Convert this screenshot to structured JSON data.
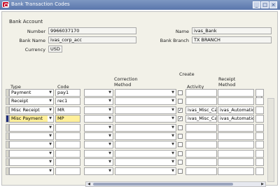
{
  "window": {
    "title": "Bank Transaction Codes",
    "buttons": [
      "_",
      "□",
      "×"
    ]
  },
  "bank_account": {
    "section_title": "Bank Account",
    "number_label": "Number",
    "number_value": "9966037170",
    "bank_name_label": "Bank Name",
    "bank_name_value": "ivas_corp_acc",
    "currency_label": "Currency",
    "currency_value": "USD",
    "name_label": "Name",
    "name_value": "ivas_Bank",
    "branch_label": "Bank Branch",
    "branch_value": "TX BRANCH"
  },
  "table": {
    "headers": {
      "type": "Type",
      "code": "Code",
      "correction_method": "Correction\nMethod",
      "create": "Create",
      "activity": "Activity",
      "receipt_method": "Receipt\nMethod",
      "extra": "[ ]"
    },
    "rows": [
      {
        "type": "Payment",
        "code": "pay1",
        "create": false,
        "activity": "",
        "receipt_method": ""
      },
      {
        "type": "Receipt",
        "code": "rec1",
        "create": false,
        "activity": "",
        "receipt_method": ""
      },
      {
        "type": "Misc Receipt",
        "code": "MR",
        "create": true,
        "activity": "ivas_Misc_Ca",
        "receipt_method": "ivas_AutomaticR"
      },
      {
        "type": "Misc Payment",
        "code": "MP",
        "create": true,
        "activity": "ivas_Misc_Ca",
        "receipt_method": "ivas_AutomaticR"
      }
    ],
    "current_row": 4,
    "total_rows": 10
  }
}
